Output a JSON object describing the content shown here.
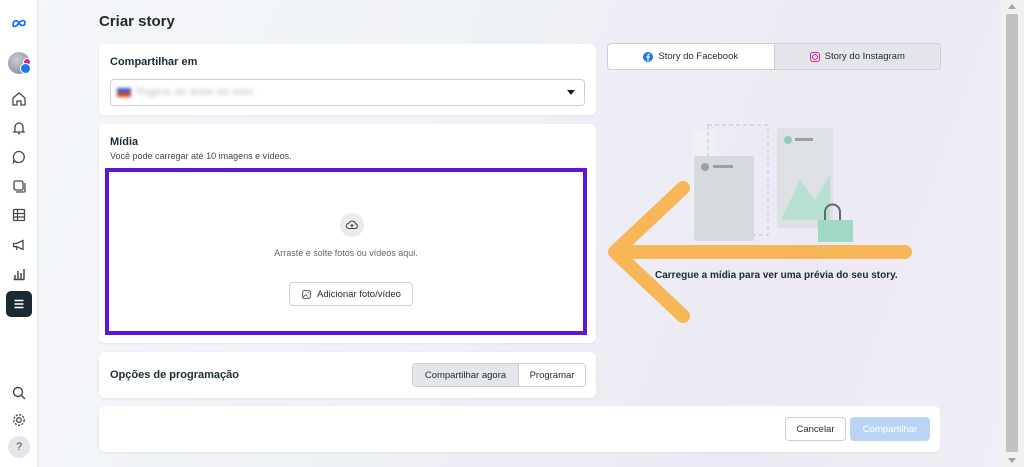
{
  "page": {
    "title": "Criar story"
  },
  "sidebar": {
    "items": [
      {
        "icon": "meta-logo-icon"
      },
      {
        "icon": "account-avatar"
      },
      {
        "icon": "home-icon"
      },
      {
        "icon": "bell-icon"
      },
      {
        "icon": "chat-bubble-icon"
      },
      {
        "icon": "pages-icon"
      },
      {
        "icon": "grid-table-icon"
      },
      {
        "icon": "megaphone-icon"
      },
      {
        "icon": "bar-chart-icon"
      },
      {
        "icon": "menu-icon",
        "active": true
      },
      {
        "icon": "search-icon"
      },
      {
        "icon": "gear-icon"
      },
      {
        "icon": "help-icon",
        "label": "?"
      }
    ]
  },
  "share_to": {
    "label": "Compartilhar em",
    "selected_value": "Pagina de teste do sítio"
  },
  "media": {
    "label": "Mídia",
    "subtitle": "Você pode carregar até 10 imagens e vídeos.",
    "drop_text": "Arraste e solte fotos ou vídeos aqui.",
    "add_button": "Adicionar foto/vídeo"
  },
  "schedule": {
    "label": "Opções de programação",
    "options": [
      "Compartilhar agora",
      "Programar"
    ],
    "selected": "Compartilhar agora"
  },
  "footer": {
    "cancel": "Cancelar",
    "share": "Compartilhar"
  },
  "preview": {
    "tabs": [
      "Story do Facebook",
      "Story do Instagram"
    ],
    "active_tab": "Story do Instagram",
    "caption": "Carregue a mídia para ver uma prévia do seu story."
  },
  "colors": {
    "highlight_border": "#5b18d6",
    "annotation_arrow": "#f7b24a",
    "primary_disabled": "#b9d4f5",
    "brand_blue": "#1877f2"
  }
}
